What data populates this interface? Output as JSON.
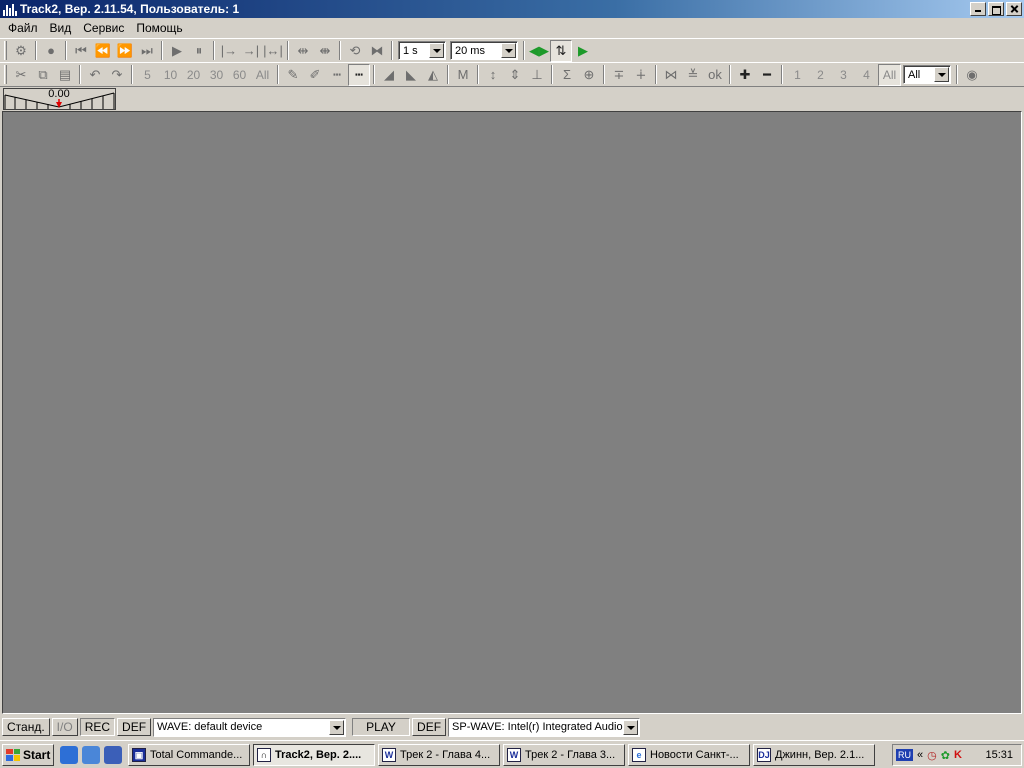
{
  "window": {
    "title": "Track2, Вер. 2.11.54,  Пользователь: 1"
  },
  "menu": [
    "Файл",
    "Вид",
    "Сервис",
    "Помощь"
  ],
  "toolbar1": {
    "duration_combo": "1 s",
    "step_combo": "20 ms"
  },
  "toolbar2": {
    "zoom_levels": [
      "5",
      "10",
      "20",
      "30",
      "60",
      "All"
    ],
    "channels": [
      "1",
      "2",
      "3",
      "4",
      "All"
    ],
    "channel_filter_combo": "All",
    "ok_label": "ok"
  },
  "meter": {
    "value": "0.00"
  },
  "statusbar": {
    "mode_button": "Станд.",
    "io_button": "I/O",
    "rec_label": "REC",
    "rec_def": "DEF",
    "rec_device": "WAVE: default device",
    "play_label": "PLAY",
    "play_def": "DEF",
    "play_device": "SP-WAVE: Intel(r) Integrated Audio"
  },
  "taskbar": {
    "start_label": "Start",
    "tasks": [
      {
        "label": "Total Commande...",
        "icon": "floppy-icon"
      },
      {
        "label": "Track2, Вер. 2....",
        "icon": "track-icon",
        "active": true
      },
      {
        "label": "Трек 2 - Глава 4...",
        "icon": "word-icon"
      },
      {
        "label": "Трек 2 - Глава 3...",
        "icon": "word-icon"
      },
      {
        "label": "Новости Санкт-...",
        "icon": "ie-icon"
      },
      {
        "label": "Джинн, Вер. 2.1...",
        "icon": "dj-icon"
      }
    ],
    "tray": {
      "lang": "RU",
      "chevron": "«",
      "time": "15:31"
    }
  },
  "colors": {
    "title_start": "#0a246a",
    "title_end": "#a6caf0",
    "workspace": "#808080",
    "chrome": "#d4d0c8"
  }
}
